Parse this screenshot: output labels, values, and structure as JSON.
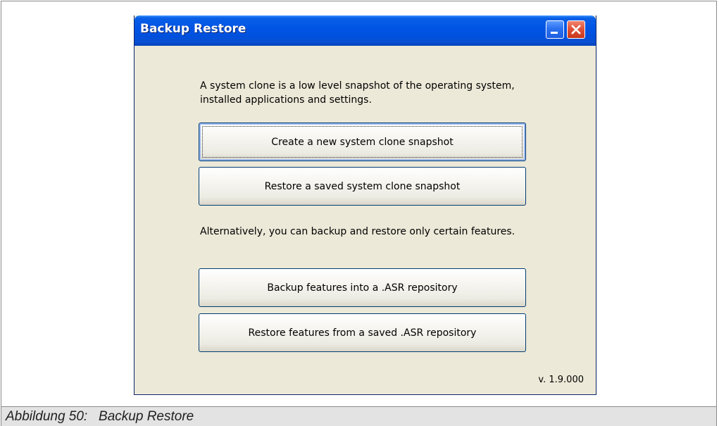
{
  "window": {
    "title": "Backup Restore",
    "minimize_icon": "minimize-icon",
    "close_icon": "close-icon"
  },
  "content": {
    "intro_text": "A system clone is a low level snapshot of the operating system, installed applications and settings.",
    "buttons": [
      {
        "label": "Create a new system clone snapshot"
      },
      {
        "label": "Restore a saved system clone snapshot"
      }
    ],
    "alt_text": "Alternatively, you can backup and restore only certain features.",
    "feature_buttons": [
      {
        "label": "Backup features into a .ASR repository"
      },
      {
        "label": "Restore features from a saved .ASR repository"
      }
    ],
    "version": "v. 1.9.000"
  },
  "figure": {
    "caption": "Abbildung 50:   Backup Restore"
  },
  "colors": {
    "titlebar": "#0055e5",
    "window_bg": "#ece9d8",
    "close_button": "#e0533a"
  }
}
